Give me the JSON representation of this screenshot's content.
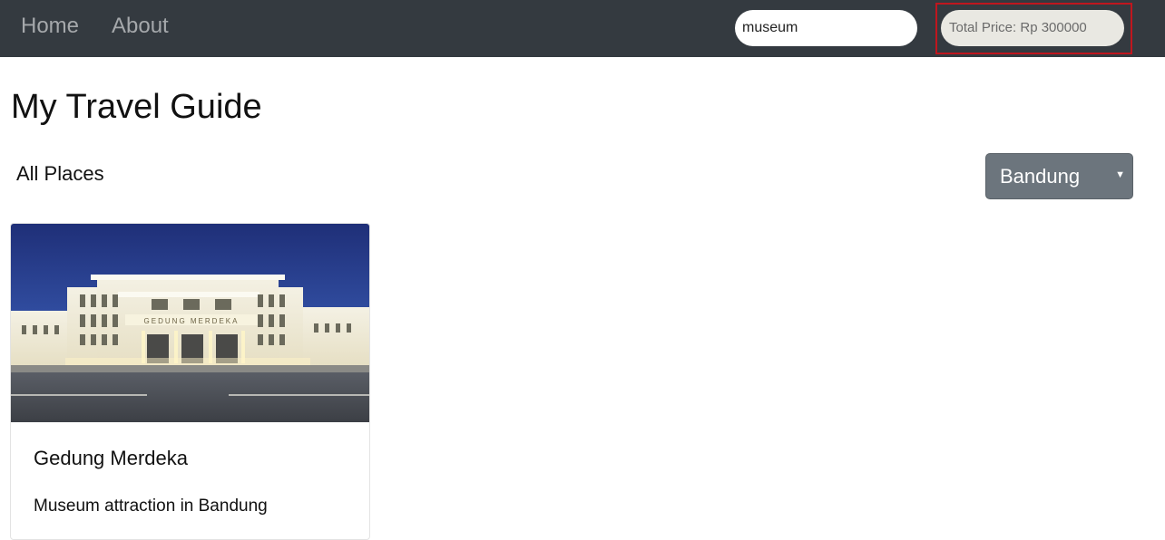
{
  "nav": {
    "home_label": "Home",
    "about_label": "About",
    "search": {
      "value": "museum",
      "placeholder": ""
    },
    "total_price_label": "Total Price: Rp 300000"
  },
  "colors": {
    "navbar_bg": "#343a40",
    "highlight_border": "#c0161e",
    "select_bg": "#6c757d",
    "total_price_bg": "#e9e8e2"
  },
  "page_title": "My Travel Guide",
  "section_label": "All Places",
  "city_select": {
    "selected": "Bandung",
    "caret_icon": "caret-down-icon"
  },
  "places": [
    {
      "image_icon": "building-photo",
      "building_sign": "GEDUNG MERDEKA",
      "name": "Gedung Merdeka",
      "subtitle": "Museum attraction in Bandung"
    }
  ]
}
